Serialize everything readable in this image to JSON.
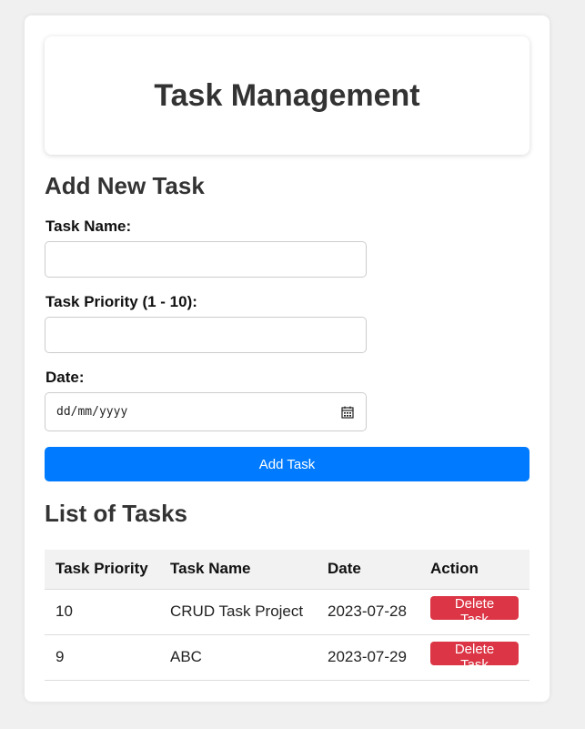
{
  "header": {
    "title": "Task Management"
  },
  "form": {
    "title": "Add New Task",
    "name_label": "Task Name:",
    "name_value": "",
    "priority_label": "Task Priority (1 - 10):",
    "priority_value": "",
    "date_label": "Date:",
    "date_placeholder": "dd/mm/yyyy",
    "date_icon": "calendar-icon",
    "submit_label": "Add Task"
  },
  "list": {
    "title": "List of Tasks",
    "columns": [
      "Task Priority",
      "Task Name",
      "Date",
      "Action"
    ],
    "rows": [
      {
        "priority": "10",
        "name": "CRUD Task Project",
        "date": "2023-07-28",
        "action": "Delete Task"
      },
      {
        "priority": "9",
        "name": "ABC",
        "date": "2023-07-29",
        "action": "Delete Task"
      }
    ]
  },
  "colors": {
    "primary": "#007bff",
    "danger": "#dc3545",
    "page_background": "#f0f0f0",
    "card_background": "#ffffff",
    "heading_text": "#333333"
  }
}
